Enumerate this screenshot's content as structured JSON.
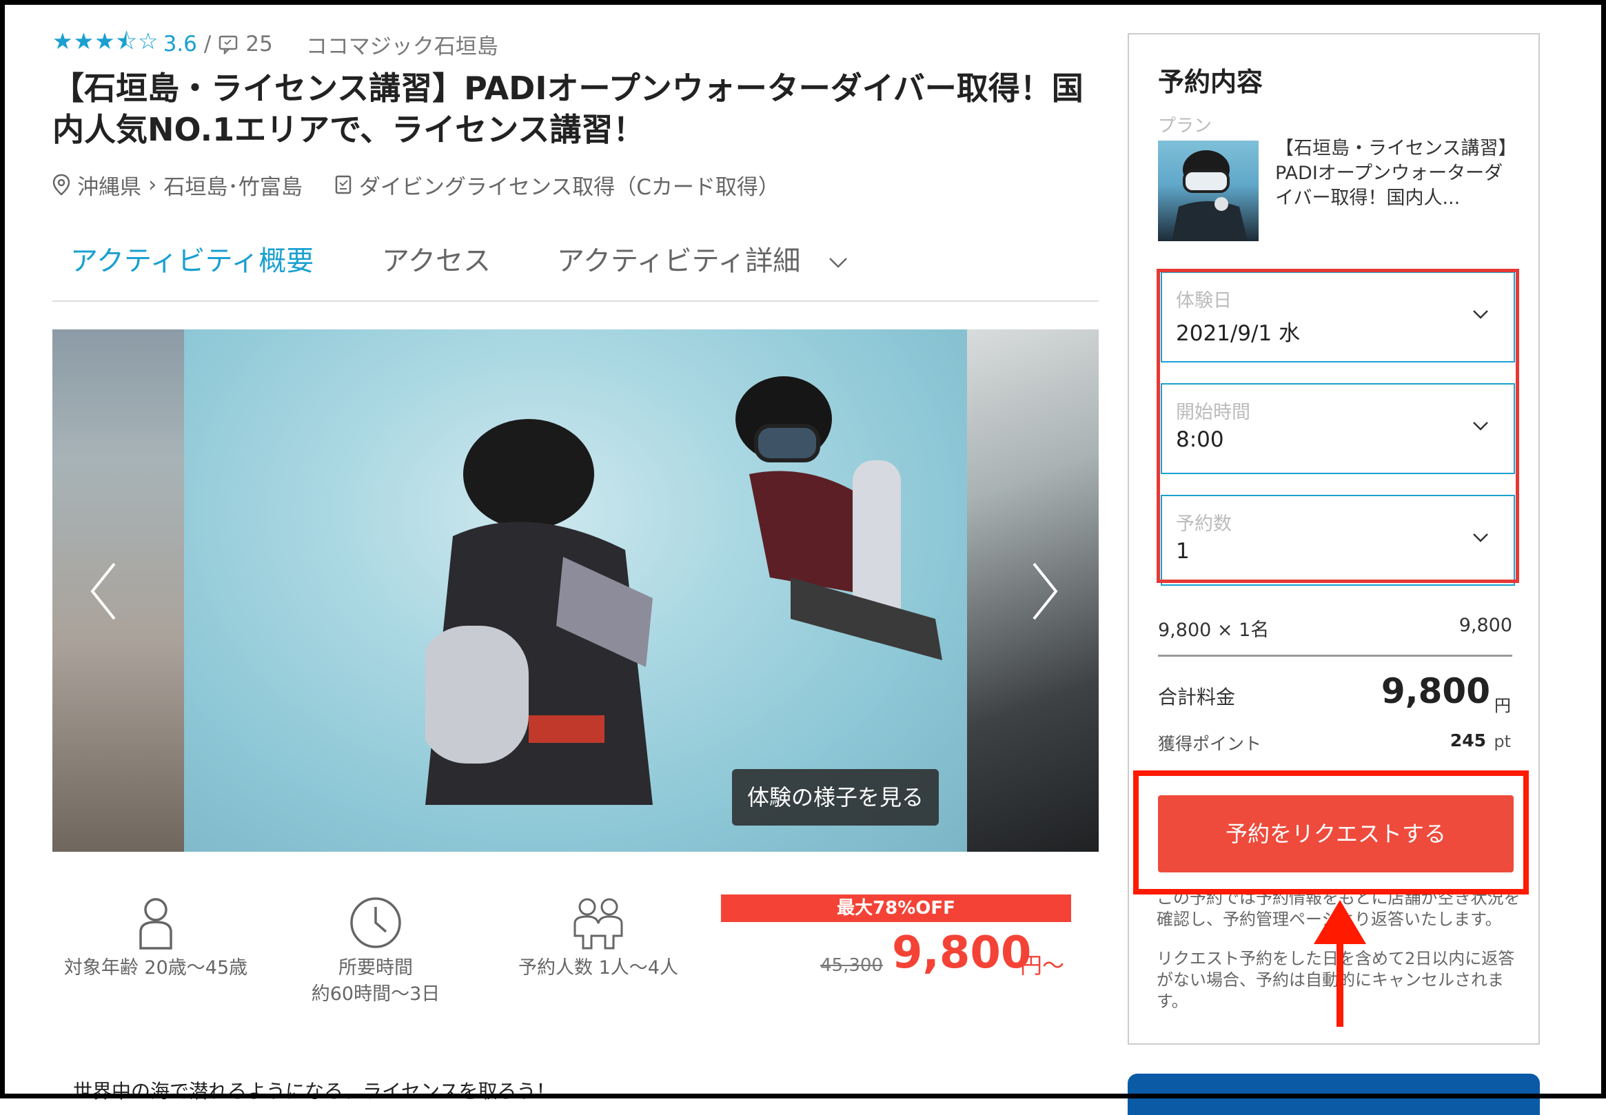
{
  "header": {
    "stars": "★★★⯪☆",
    "rating": "3.6",
    "separator": "/",
    "review_count": "25",
    "shop_name": "ココマジック石垣島",
    "title": "【石垣島・ライセンス講習】PADIオープンウォーターダイバー取得！国内人気NO.1エリアで、ライセンス講習！",
    "location_pref": "沖縄県",
    "location_city": "石垣島･竹富島",
    "category": "ダイビングライセンス取得（Cカード取得）"
  },
  "tabs": [
    {
      "label": "アクティビティ概要"
    },
    {
      "label": "アクセス"
    },
    {
      "label": "アクティビティ詳細"
    }
  ],
  "gallery": {
    "view_button": "体験の様子を見る"
  },
  "info": {
    "age": "対象年齢 20歳〜45歳",
    "duration_label": "所要時間",
    "duration_value": "約60時間〜3日",
    "people": "予約人数 1人〜4人"
  },
  "price": {
    "discount": "最大78%OFF",
    "original": "45,300",
    "current": "9,800",
    "unit": "円〜"
  },
  "description_peek": "世界中の海で潜れるようになる、ライセンスを取ろう！",
  "sidebar": {
    "title": "予約内容",
    "plan_label": "プラン",
    "plan_name": "【石垣島・ライセンス講習】PADIオープンウォーターダイバー取得！国内人...",
    "date_label": "体験日",
    "date_value": "2021/9/1 水",
    "time_label": "開始時間",
    "time_value": "8:00",
    "count_label": "予約数",
    "count_value": "1",
    "calc_label": "9,800 × 1名",
    "calc_value": "9,800",
    "total_label": "合計料金",
    "total_value": "9,800",
    "total_unit": "円",
    "points_label": "獲得ポイント",
    "points_value": "245",
    "points_unit": "pt",
    "request_button": "予約をリクエストする",
    "note1": "この予約では予約情報をもとに店舗が空き状況を確認し、予約管理ページより返答いたします。",
    "note2": "リクエスト予約をした日を含めて2日以内に返答がない場合、予約は自動的にキャンセルされます。"
  },
  "colors": {
    "accent": "#1aa0d0",
    "price_red": "#f44336",
    "button_red": "#ee4b3c",
    "annotation_red": "#ff1a00"
  }
}
